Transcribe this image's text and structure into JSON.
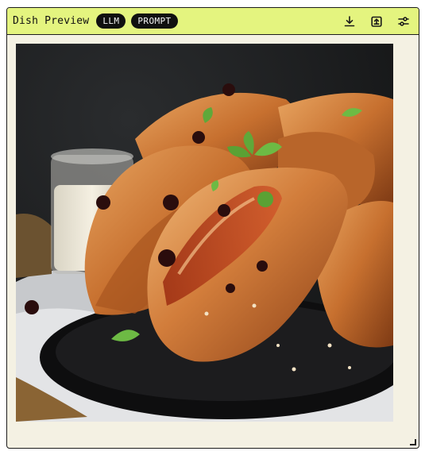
{
  "node": {
    "title": "Dish Preview",
    "badges": [
      "LLM",
      "PROMPT"
    ],
    "header_color": "#e4f47f",
    "body_color": "#f4f1e3",
    "tools": [
      "download-icon",
      "upload-icon",
      "sliders-icon"
    ]
  },
  "preview": {
    "subject": "glazed-chicken-wings-photo"
  }
}
